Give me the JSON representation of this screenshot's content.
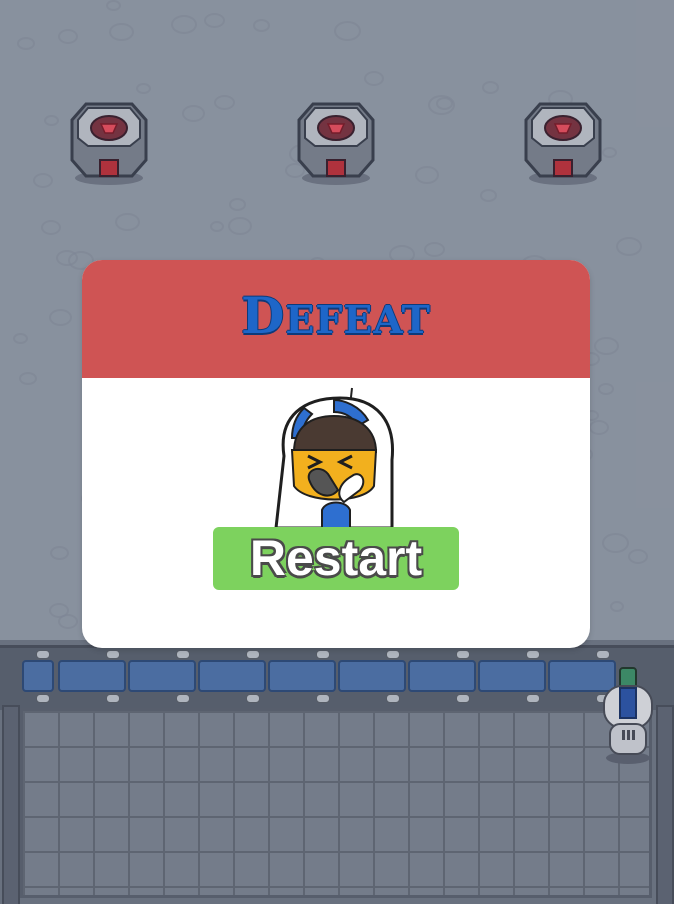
{
  "game": {
    "dialog": {
      "title_initial": "D",
      "title_rest": "EFEAT",
      "restart_label": "Restart"
    },
    "turrets": [
      {
        "name": "turret-left",
        "icon": "gem-turret-icon"
      },
      {
        "name": "turret-center",
        "icon": "gem-turret-icon"
      },
      {
        "name": "turret-right",
        "icon": "gem-turret-icon"
      }
    ],
    "colors": {
      "header": "#cf5454",
      "title": "#1e66c8",
      "restart_button": "#7dd25e",
      "wall_panel": "#4f72a8",
      "ground": "#8f98a5"
    }
  }
}
